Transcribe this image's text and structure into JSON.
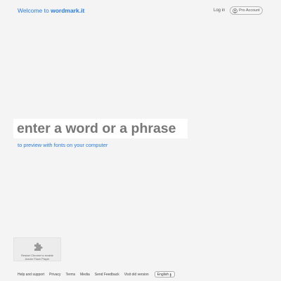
{
  "header": {
    "brand_prefix": "Welcome to ",
    "brand_name": "wordmark.it",
    "login_label": "Log in",
    "pro_label": "Pro Account",
    "pro_icon": "person-circle-icon"
  },
  "main": {
    "phrase_placeholder": "enter a word or a phrase",
    "phrase_value": "",
    "subtitle": "to preview with fonts on your computer"
  },
  "plugin_notice": {
    "icon": "puzzle-piece-icon",
    "line1": "Restart Chrome to enable",
    "line2": "Adobe Flash Player"
  },
  "footer": {
    "links": {
      "help": "Help and support",
      "privacy": "Privacy",
      "terms": "Terms",
      "media": "Media",
      "feedback": "Send Feedback",
      "old_version": "Visit old version"
    },
    "language": "English"
  },
  "colors": {
    "accent": "#2a7be4",
    "background": "#f4f4f4"
  }
}
